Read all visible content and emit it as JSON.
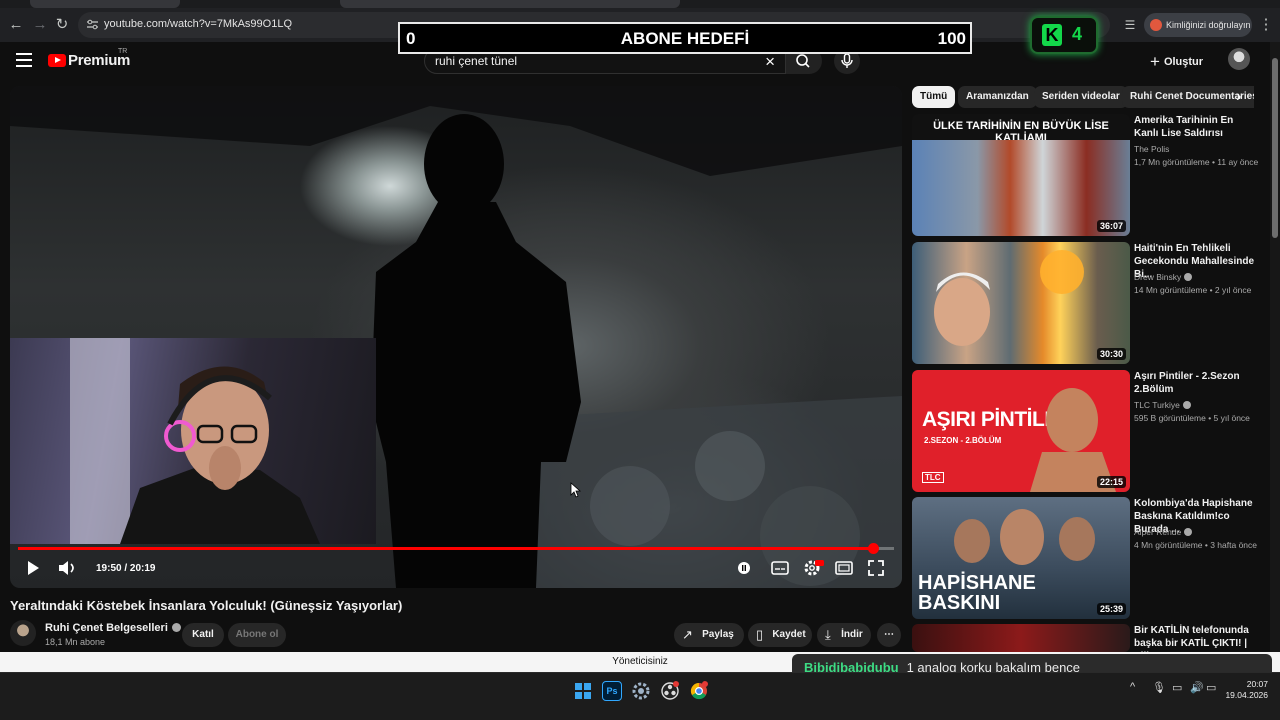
{
  "browser": {
    "url": "youtube.com/watch?v=7MkAs99O1LQ",
    "profile_label": "Kimliğinizi doğrulayın"
  },
  "overlay": {
    "goal_left": "0",
    "goal_title": "ABONE HEDEFİ",
    "goal_right": "100",
    "k_letter": "K",
    "k_count": "4"
  },
  "header": {
    "logo_text": "Premium",
    "logo_region": "TR",
    "search_value": "ruhi çenet tünel",
    "create_label": "Oluştur"
  },
  "player": {
    "time": "19:50 / 20:19",
    "progress": 0.976
  },
  "video": {
    "title": "Yeraltındaki Köstebek İnsanlara Yolculuk! (Güneşsiz Yaşıyorlar)",
    "channel": "Ruhi Çenet Belgeselleri",
    "subscribers": "18,1 Mn abone",
    "join_label": "Katıl",
    "subscribe_label": "Abone ol",
    "share_label": "Paylaş",
    "save_label": "Kaydet",
    "download_label": "İndir"
  },
  "chips": [
    "Tümü",
    "Aramanızdan",
    "Seriden videolar",
    "Ruhi Cenet Documentaries"
  ],
  "recommendations": [
    {
      "title": "Amerika Tarihinin En Kanlı Lise Saldırısı",
      "channel": "The Polis",
      "verified": false,
      "meta": "1,7 Mn görüntüleme • 11 ay önce",
      "duration": "36:07",
      "thumb_text": "ÜLKE TARİHİNİN EN BÜYÜK LİSE KATLİAMI"
    },
    {
      "title": "Haiti'nin En Tehlikeli Gecekondu Mahallesinde Bi...",
      "channel": "Drew Binsky",
      "verified": true,
      "meta": "14 Mn görüntüleme • 2 yıl önce",
      "duration": "30:30",
      "thumb_text": ""
    },
    {
      "title": "Aşırı Pintiler - 2.Sezon 2.Bölüm",
      "channel": "TLC Turkiye",
      "verified": true,
      "meta": "595 B görüntüleme • 5 yıl önce",
      "duration": "22:15",
      "thumb_text": "AŞIRI PİNTİLER",
      "thumb_sub": "2.SEZON - 2.BÖLÜM",
      "thumb_logo": "TLC"
    },
    {
      "title": "Kolombiya'da Hapishane Baskına Katıldım!co Burada ...",
      "channel": "Alper Rende",
      "verified": true,
      "meta": "4 Mn görüntüleme • 3 hafta önce",
      "duration": "25:39",
      "thumb_text": "HAPİSHANE BASKINI"
    },
    {
      "title": "Bir KATİLİN telefonunda başka bir KATİL ÇIKTI! | Ellio...",
      "channel": "",
      "verified": false,
      "meta": "",
      "duration": "",
      "thumb_text": ""
    }
  ],
  "bottom": {
    "admin_text": "Yöneticisiniz",
    "chat_user": "Bibidibabidubu",
    "chat_message": "1 analog korku bakalım bence",
    "clock_time": "20:07",
    "clock_date": "19.04.2026"
  },
  "colors": {
    "accent": "#ff0000",
    "chat_user": "#3ddc84",
    "k_badge": "#13d84a"
  }
}
